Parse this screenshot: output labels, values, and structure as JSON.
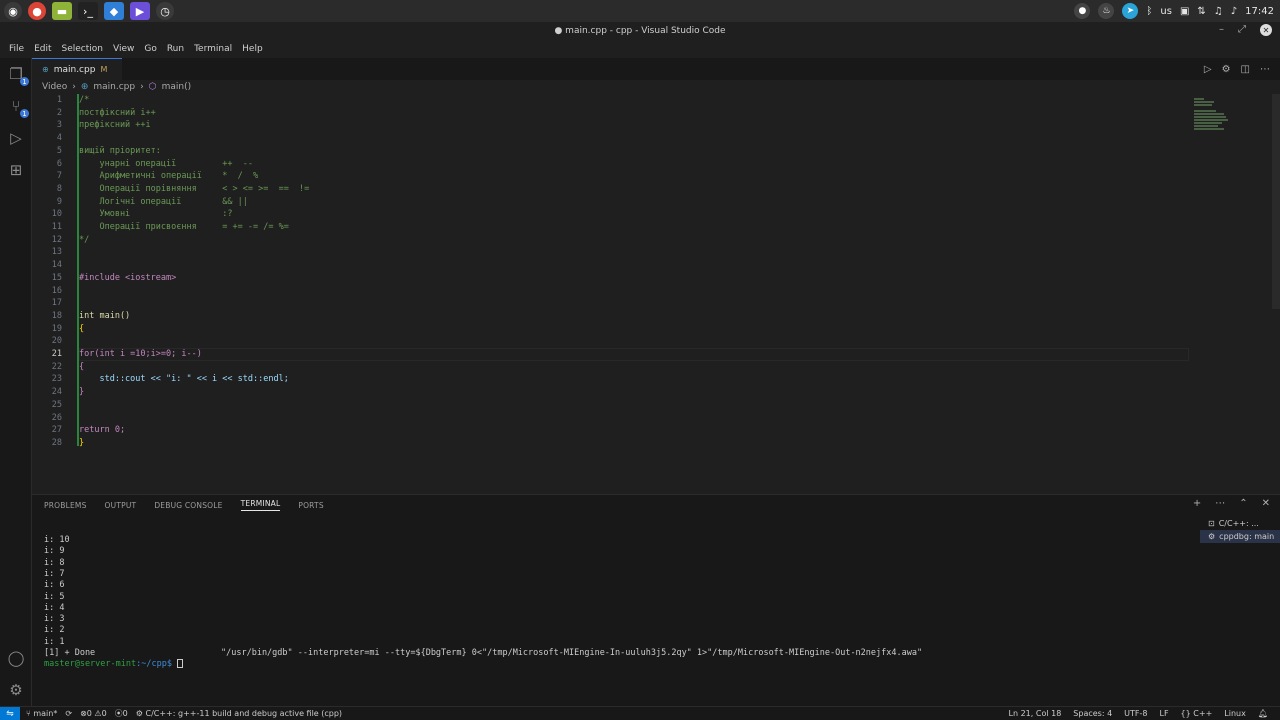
{
  "system_bar": {
    "taskbar_icons": [
      "mint-menu-icon",
      "chrome-icon",
      "files-icon",
      "terminal-icon",
      "vscode-icon",
      "media-icon",
      "timeshift-icon"
    ],
    "keyboard_layout": "us",
    "clock": "17:42"
  },
  "window": {
    "title": "● main.cpp - cpp - Visual Studio Code"
  },
  "menu": [
    "File",
    "Edit",
    "Selection",
    "View",
    "Go",
    "Run",
    "Terminal",
    "Help"
  ],
  "tab": {
    "label": "main.cpp",
    "modified_marker": "M"
  },
  "breadcrumb": {
    "folder": "Video",
    "file": "main.cpp",
    "symbol": "main()"
  },
  "editor": {
    "active_line": 21,
    "lines": [
      "/*",
      "постфіксний i++",
      "префіксний ++i",
      "",
      "вищій пріоритет:",
      "    унарні операції         ++  --",
      "    Арифметичні операції    *  /  %",
      "    Операції порівняння     < > <= >=  ==  !=",
      "    Логічні операції        && ||",
      "    Умовні                  :?",
      "    Операції присвоєння     = += -= /= %=",
      "*/",
      "",
      "",
      "#include <iostream>",
      "",
      "",
      "int main()",
      "{",
      "",
      "for(int i =10;i>=0; i--)",
      "{",
      "    std::cout << \"i: \" << i << std::endl;",
      "}",
      "",
      "",
      "return 0;",
      "}"
    ]
  },
  "panel": {
    "tabs": [
      "PROBLEMS",
      "OUTPUT",
      "DEBUG CONSOLE",
      "TERMINAL",
      "PORTS"
    ],
    "active_tab": "TERMINAL",
    "terminal_output": [
      "i: 10",
      "i: 9",
      "i: 8",
      "i: 7",
      "i: 6",
      "i: 5",
      "i: 4",
      "i: 3",
      "i: 2",
      "i: 1"
    ],
    "done_line_prefix": "[1] + Done",
    "done_line_command": "\"/usr/bin/gdb\" --interpreter=mi --tty=${DbgTerm} 0<\"/tmp/Microsoft-MIEngine-In-uuluh3j5.2qy\" 1>\"/tmp/Microsoft-MIEngine-Out-n2nejfx4.awa\"",
    "prompt_user": "master@server-mint",
    "prompt_path": ":~/cpp$",
    "terminals": [
      "C/C++: ...",
      "cppdbg: main"
    ]
  },
  "status_bar": {
    "branch": "main*",
    "errors": "0",
    "warnings": "0",
    "ports": "0",
    "task": "C/C++: g++-11 build and debug active file (cpp)",
    "position": "Ln 21, Col 18",
    "spaces": "Spaces: 4",
    "encoding": "UTF-8",
    "eol": "LF",
    "language": "C++",
    "platform": "Linux"
  },
  "colors": {
    "accent": "#0078d4",
    "comment": "#6a9955",
    "keyword": "#569cd6",
    "preprocessor": "#c586c0",
    "string": "#ce9178",
    "git_added": "#2ea043"
  }
}
